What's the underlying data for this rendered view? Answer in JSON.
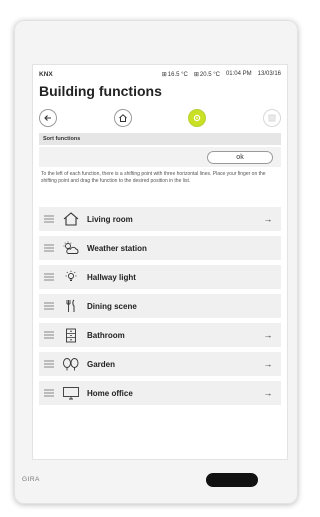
{
  "status_bar": {
    "knx": "KNX",
    "temp1": "16.5 °C",
    "temp2": "20.5 °C",
    "time": "01:04 PM",
    "date": "13/03/16"
  },
  "page_title": "Building functions",
  "nav": {
    "back_icon": "arrow-left",
    "home_icon": "home",
    "settings_icon": "gear",
    "grid_icon": "grid"
  },
  "sort": {
    "header": "Sort functions",
    "ok_label": "ok",
    "help": "To the left of each function, there is a shifting point with three horizontal lines. Place your finger on the shifting point and drag the function to the desired position in the list."
  },
  "functions": [
    {
      "label": "Living room",
      "icon": "house-outline",
      "has_arrow": true,
      "arrow": "→"
    },
    {
      "label": "Weather station",
      "icon": "sun-cloud",
      "has_arrow": false,
      "arrow": ""
    },
    {
      "label": "Hallway light",
      "icon": "light-bulb",
      "has_arrow": false,
      "arrow": ""
    },
    {
      "label": "Dining scene",
      "icon": "fork-knife",
      "has_arrow": false,
      "arrow": ""
    },
    {
      "label": "Bathroom",
      "icon": "cabinet",
      "has_arrow": true,
      "arrow": "→"
    },
    {
      "label": "Garden",
      "icon": "trees",
      "has_arrow": true,
      "arrow": "→"
    },
    {
      "label": "Home office",
      "icon": "monitor",
      "has_arrow": true,
      "arrow": "→"
    }
  ],
  "device": {
    "brand": "GIRA"
  },
  "colors": {
    "accent_green": "#c9e024",
    "list_bg": "#f0f0f0"
  }
}
